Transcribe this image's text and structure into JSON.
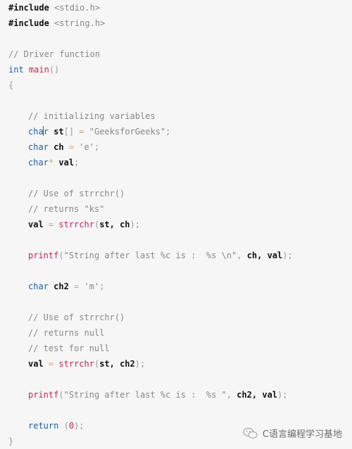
{
  "code": {
    "language": "C",
    "lines": [
      {
        "tokens": [
          {
            "t": "pre",
            "v": "#include "
          },
          {
            "t": "str",
            "v": "<stdio.h>"
          }
        ]
      },
      {
        "tokens": [
          {
            "t": "pre",
            "v": "#include "
          },
          {
            "t": "str",
            "v": "<string.h>"
          }
        ]
      },
      {
        "tokens": []
      },
      {
        "tokens": [
          {
            "t": "cm",
            "v": "// Driver function"
          }
        ]
      },
      {
        "tokens": [
          {
            "t": "kw",
            "v": "int"
          },
          {
            "t": "id0",
            "v": " "
          },
          {
            "t": "fn",
            "v": "main"
          },
          {
            "t": "pn",
            "v": "()"
          }
        ]
      },
      {
        "tokens": [
          {
            "t": "pn",
            "v": "{"
          }
        ]
      },
      {
        "tokens": []
      },
      {
        "indent": 1,
        "tokens": [
          {
            "t": "cm",
            "v": "// initializing variables"
          }
        ]
      },
      {
        "indent": 1,
        "tokens": [
          {
            "t": "kw",
            "v": "cha"
          },
          {
            "t": "caret",
            "v": ""
          },
          {
            "t": "kw",
            "v": "r"
          },
          {
            "t": "id",
            "v": " st"
          },
          {
            "t": "pn",
            "v": "[]"
          },
          {
            "t": "op",
            "v": " = "
          },
          {
            "t": "str",
            "v": "\"GeeksforGeeks\""
          },
          {
            "t": "pn",
            "v": ";"
          }
        ]
      },
      {
        "indent": 1,
        "tokens": [
          {
            "t": "kw",
            "v": "char"
          },
          {
            "t": "id",
            "v": " ch"
          },
          {
            "t": "op",
            "v": " = "
          },
          {
            "t": "str",
            "v": "'e'"
          },
          {
            "t": "pn",
            "v": ";"
          }
        ]
      },
      {
        "indent": 1,
        "tokens": [
          {
            "t": "kw",
            "v": "char"
          },
          {
            "t": "op",
            "v": "*"
          },
          {
            "t": "id",
            "v": " val"
          },
          {
            "t": "pn",
            "v": ";"
          }
        ]
      },
      {
        "tokens": []
      },
      {
        "indent": 1,
        "tokens": [
          {
            "t": "cm",
            "v": "// Use of strrchr()"
          }
        ]
      },
      {
        "indent": 1,
        "tokens": [
          {
            "t": "cm",
            "v": "// returns \"ks\""
          }
        ]
      },
      {
        "indent": 1,
        "tokens": [
          {
            "t": "id",
            "v": "val"
          },
          {
            "t": "op",
            "v": " = "
          },
          {
            "t": "fn",
            "v": "strrchr"
          },
          {
            "t": "pn",
            "v": "("
          },
          {
            "t": "id",
            "v": "st, ch"
          },
          {
            "t": "pn",
            "v": ");"
          }
        ]
      },
      {
        "tokens": []
      },
      {
        "indent": 1,
        "tokens": [
          {
            "t": "fn",
            "v": "printf"
          },
          {
            "t": "pn",
            "v": "("
          },
          {
            "t": "str",
            "v": "\"String after last %c is :  %s \\n\""
          },
          {
            "t": "pn",
            "v": ", "
          },
          {
            "t": "id",
            "v": "ch, val"
          },
          {
            "t": "pn",
            "v": ");"
          }
        ]
      },
      {
        "tokens": []
      },
      {
        "indent": 1,
        "tokens": [
          {
            "t": "kw",
            "v": "char"
          },
          {
            "t": "id",
            "v": " ch2"
          },
          {
            "t": "op",
            "v": " = "
          },
          {
            "t": "str",
            "v": "'m'"
          },
          {
            "t": "pn",
            "v": ";"
          }
        ]
      },
      {
        "tokens": []
      },
      {
        "indent": 1,
        "tokens": [
          {
            "t": "cm",
            "v": "// Use of strrchr()"
          }
        ]
      },
      {
        "indent": 1,
        "tokens": [
          {
            "t": "cm",
            "v": "// returns null"
          }
        ]
      },
      {
        "indent": 1,
        "tokens": [
          {
            "t": "cm",
            "v": "// test for null"
          }
        ]
      },
      {
        "indent": 1,
        "tokens": [
          {
            "t": "id",
            "v": "val"
          },
          {
            "t": "op",
            "v": " = "
          },
          {
            "t": "fn",
            "v": "strrchr"
          },
          {
            "t": "pn",
            "v": "("
          },
          {
            "t": "id",
            "v": "st, ch2"
          },
          {
            "t": "pn",
            "v": ");"
          }
        ]
      },
      {
        "tokens": []
      },
      {
        "indent": 1,
        "tokens": [
          {
            "t": "fn",
            "v": "printf"
          },
          {
            "t": "pn",
            "v": "("
          },
          {
            "t": "str",
            "v": "\"String after last %c is :  %s \""
          },
          {
            "t": "pn",
            "v": ", "
          },
          {
            "t": "id",
            "v": "ch2, val"
          },
          {
            "t": "pn",
            "v": ");"
          }
        ]
      },
      {
        "tokens": []
      },
      {
        "indent": 1,
        "tokens": [
          {
            "t": "kw",
            "v": "return"
          },
          {
            "t": "pn",
            "v": " ("
          },
          {
            "t": "num",
            "v": "0"
          },
          {
            "t": "pn",
            "v": ");"
          }
        ]
      },
      {
        "tokens": [
          {
            "t": "pn",
            "v": "}"
          }
        ]
      }
    ]
  },
  "watermark": {
    "icon": "wechat-icon",
    "text": "C语言编程学习基地"
  },
  "colors": {
    "background": "#f6f6f6",
    "keyword": "#1b5fa8",
    "function": "#c7254e",
    "comment": "#888888"
  }
}
